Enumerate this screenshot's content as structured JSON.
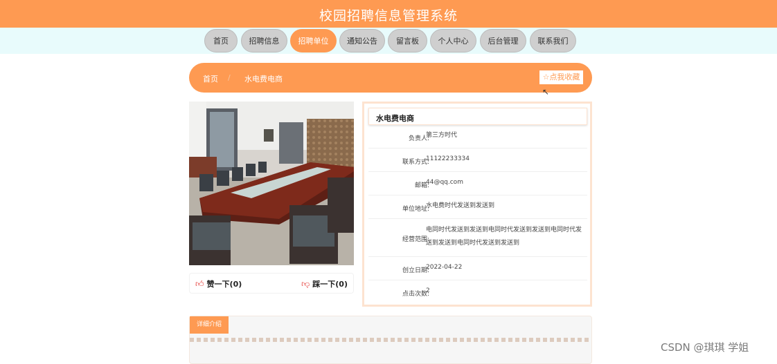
{
  "header": {
    "title": "校园招聘信息管理系统"
  },
  "nav": [
    {
      "label": "首页",
      "active": false
    },
    {
      "label": "招聘信息",
      "active": false
    },
    {
      "label": "招聘单位",
      "active": true
    },
    {
      "label": "通知公告",
      "active": false
    },
    {
      "label": "留言板",
      "active": false
    },
    {
      "label": "个人中心",
      "active": false
    },
    {
      "label": "后台管理",
      "active": false
    },
    {
      "label": "联系我们",
      "active": false
    }
  ],
  "breadcrumb": {
    "home": "首页",
    "separator": "/",
    "current": "水电费电商"
  },
  "favorite": {
    "icon": "star-outline-icon",
    "label": "点我收藏"
  },
  "likes": {
    "like_label": "赞一下(0)",
    "dislike_label": "踩一下(0)"
  },
  "company": {
    "name": "水电费电商",
    "fields": [
      {
        "label": "负责人:",
        "value": "第三方时代"
      },
      {
        "label": "联系方式:",
        "value": "11122233334"
      },
      {
        "label": "邮箱:",
        "value": "44@qq.com"
      },
      {
        "label": "单位地址:",
        "value": "水电费时代发送到发送到"
      },
      {
        "label": "经营范围:",
        "value": "电同时代发送到发送到电同时代发送到发送到电同时代发送到发送到电同时代发送到发送到"
      },
      {
        "label": "创立日期:",
        "value": "2022-04-22"
      },
      {
        "label": "点击次数:",
        "value": "2"
      }
    ]
  },
  "detail": {
    "tab_label": "详细介绍"
  },
  "watermark": "CSDN @琪琪 学姐",
  "colors": {
    "accent": "#fe9a52",
    "nav_band": "#e8fbfc",
    "nav_button": "#cfcfcf"
  }
}
